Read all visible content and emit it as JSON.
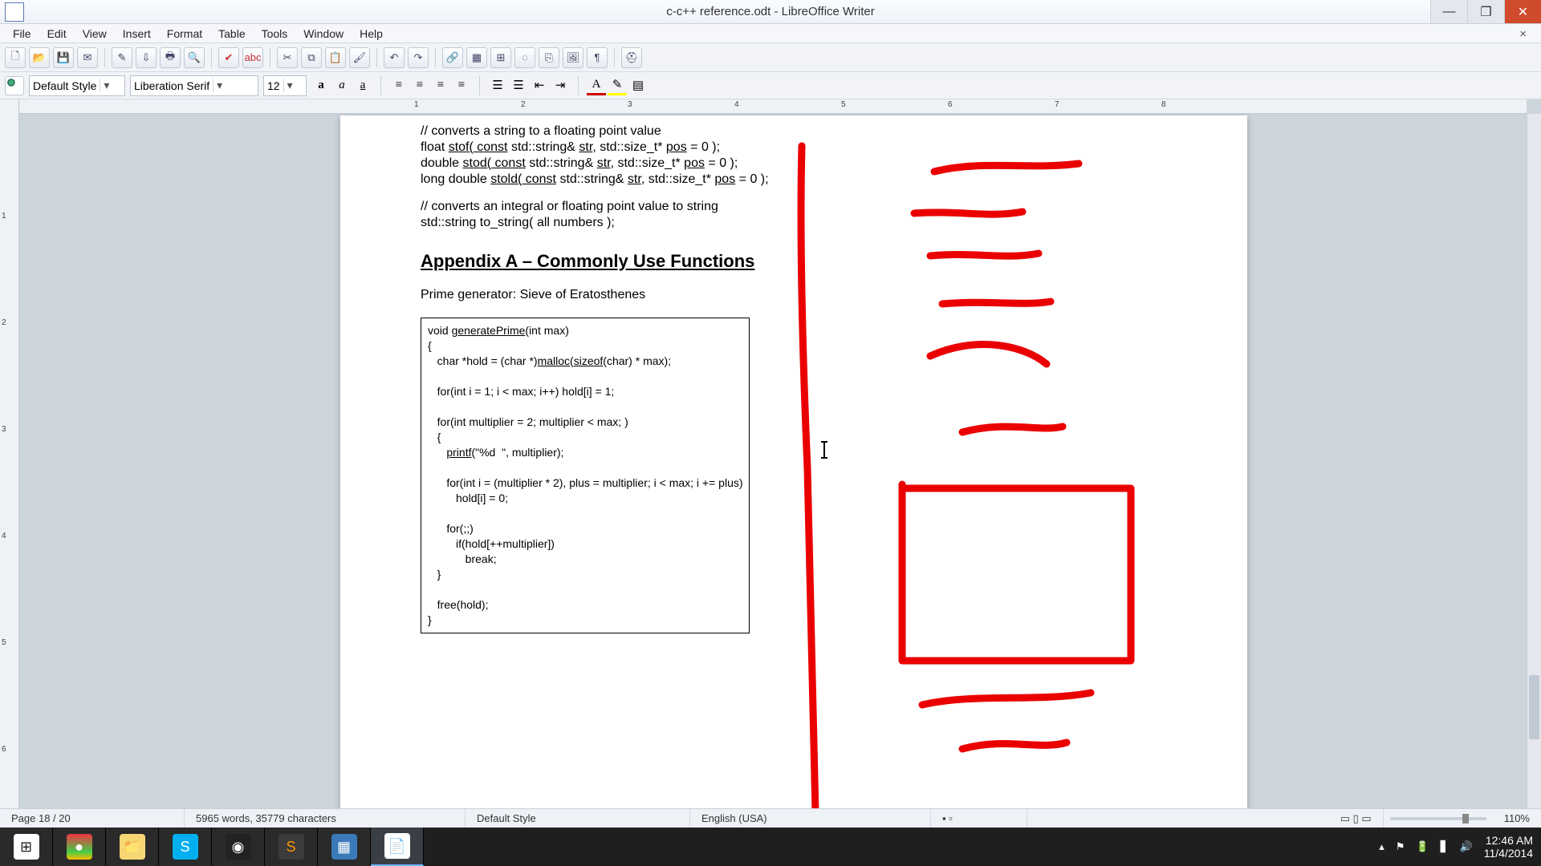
{
  "window": {
    "title": "c-c++ reference.odt - LibreOffice Writer",
    "controls": {
      "min": "—",
      "max": "❐",
      "close": "✕"
    }
  },
  "menu": {
    "items": [
      "File",
      "Edit",
      "View",
      "Insert",
      "Format",
      "Table",
      "Tools",
      "Window",
      "Help"
    ],
    "close_doc": "×"
  },
  "toolbar2": {
    "style": "Default Style",
    "font": "Liberation Serif",
    "size": "12"
  },
  "ruler_h": [
    "1",
    "2",
    "3",
    "4",
    "5",
    "6",
    "7"
  ],
  "ruler_v": [
    "1",
    "2",
    "3",
    "4",
    "5",
    "6"
  ],
  "doc": {
    "comment1": "// converts a string to a floating point value",
    "line2_a": "float ",
    "line2_b": "stof(",
    "line2_c": " const",
    "line2_d": " std::string& ",
    "line2_e": "str",
    "line2_f": ", std::size_t* ",
    "line2_g": "pos",
    "line2_h": " = 0 );",
    "line3_a": "double ",
    "line3_b": "stod(",
    "line3_c": " const",
    "line3_d": " std::string& ",
    "line3_e": "str",
    "line3_f": ", std::size_t* ",
    "line3_g": "pos",
    "line3_h": " = 0 );",
    "line4_a": "long double ",
    "line4_b": "stold(",
    "line4_c": " const",
    "line4_d": " std::string& ",
    "line4_e": "str",
    "line4_f": ", std::size_t* ",
    "line4_g": "pos",
    "line4_h": " = 0 );",
    "comment2": "// converts an integral or floating point value to string",
    "line6": "std::string to_string( all numbers );",
    "heading": "Appendix A – Commonly Use Functions",
    "para1": "Prime generator: Sieve of Eratosthenes",
    "code": {
      "l1a": "void ",
      "l1b": "generatePrime",
      "l1c": "(int max)",
      "l2": "{",
      "l3a": "   char *hold = (char *)",
      "l3b": "malloc",
      "l3c": "(",
      "l3d": "sizeof",
      "l3e": "(char) * max);",
      "l4": "",
      "l5": "   for(int i = 1; i < max; i++) hold[i] = 1;",
      "l6": "",
      "l7": "   for(int multiplier = 2; multiplier < max; )",
      "l8": "   {",
      "l9a": "      ",
      "l9b": "printf",
      "l9c": "(\"%d  \", multiplier);",
      "l10": "",
      "l11": "      for(int i = (multiplier * 2), plus = multiplier; i < max; i += plus)",
      "l12": "         hold[i] = 0;",
      "l13": "",
      "l14": "      for(;;)",
      "l15": "         if(hold[++multiplier])",
      "l16": "            break;",
      "l17": "   }",
      "l18": "",
      "l19": "   free(hold);",
      "l20": "}"
    }
  },
  "status": {
    "page": "Page 18 / 20",
    "words": "5965 words, 35779 characters",
    "style": "Default Style",
    "lang": "English (USA)",
    "zoom": "110%"
  },
  "clock": {
    "time": "12:46 AM",
    "date": "11/4/2014"
  }
}
